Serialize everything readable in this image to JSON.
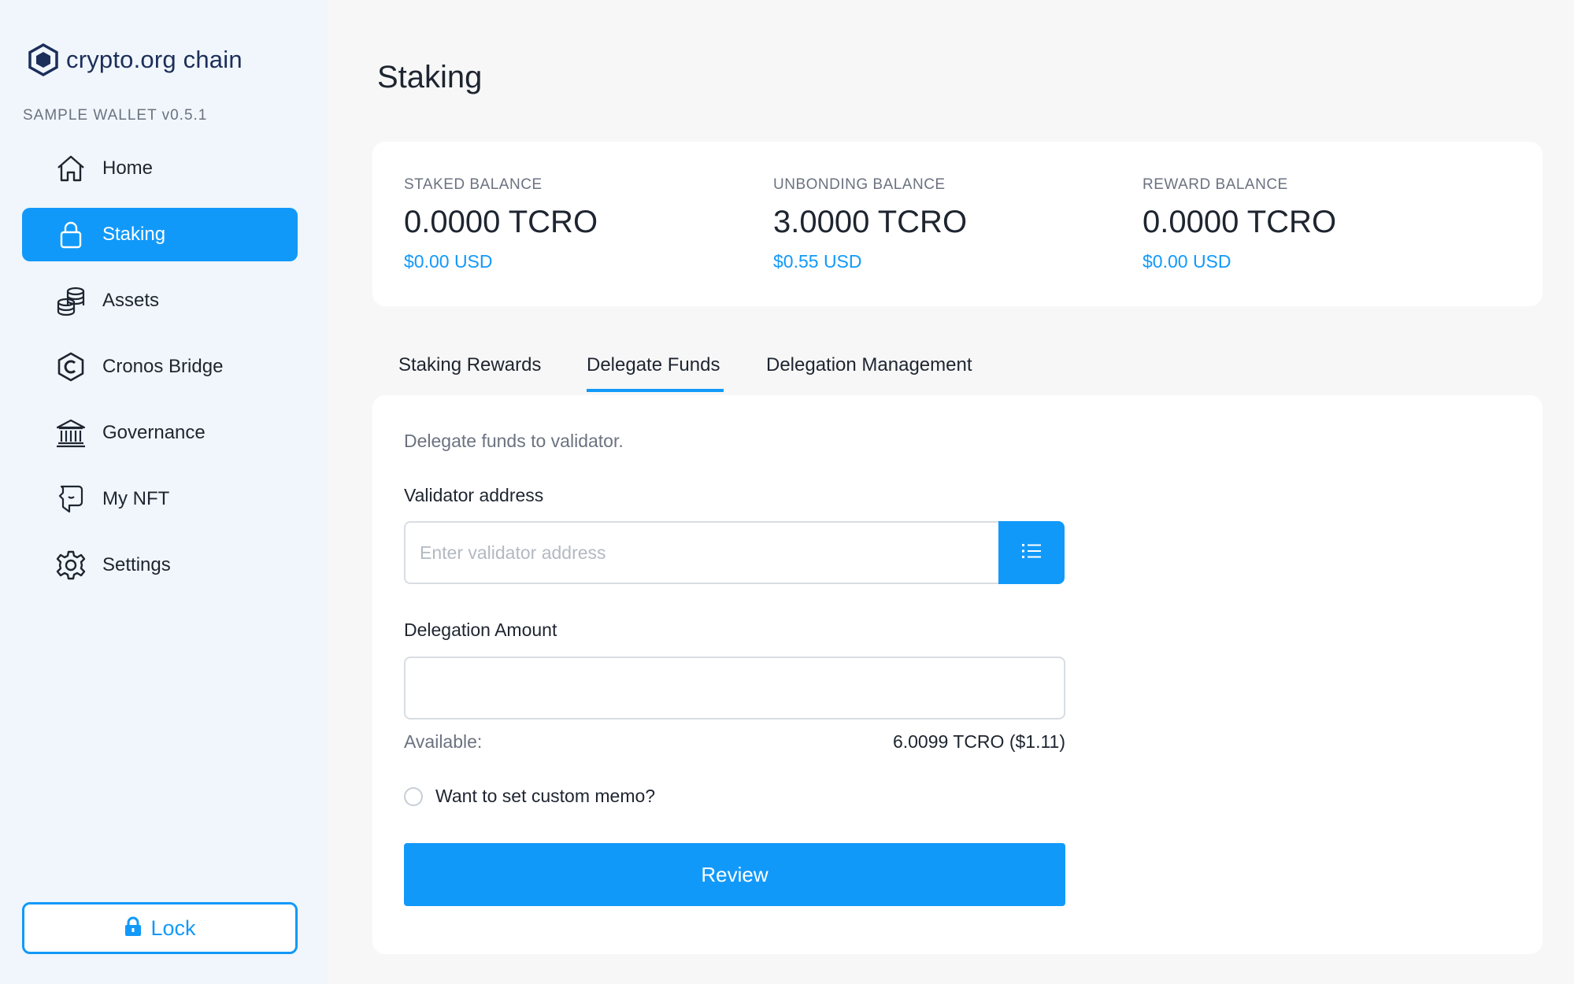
{
  "brand": {
    "name": "crypto.org chain",
    "version": "SAMPLE WALLET v0.5.1",
    "accent": "#1199fa",
    "logo_color": "#1c2e5a"
  },
  "sidebar": {
    "items": [
      {
        "label": "Home",
        "icon": "home-icon",
        "active": false
      },
      {
        "label": "Staking",
        "icon": "lock-icon",
        "active": true
      },
      {
        "label": "Assets",
        "icon": "coins-icon",
        "active": false
      },
      {
        "label": "Cronos Bridge",
        "icon": "cronos-icon",
        "active": false
      },
      {
        "label": "Governance",
        "icon": "bank-icon",
        "active": false
      },
      {
        "label": "My NFT",
        "icon": "nft-icon",
        "active": false
      },
      {
        "label": "Settings",
        "icon": "gear-icon",
        "active": false
      }
    ],
    "lock_label": "Lock"
  },
  "page": {
    "title": "Staking"
  },
  "balances": [
    {
      "title": "STAKED BALANCE",
      "value": "0.0000 TCRO",
      "usd": "$0.00 USD"
    },
    {
      "title": "UNBONDING BALANCE",
      "value": "3.0000 TCRO",
      "usd": "$0.55 USD"
    },
    {
      "title": "REWARD BALANCE",
      "value": "0.0000 TCRO",
      "usd": "$0.00 USD"
    }
  ],
  "tabs": [
    {
      "label": "Staking Rewards",
      "active": false
    },
    {
      "label": "Delegate Funds",
      "active": true
    },
    {
      "label": "Delegation Management",
      "active": false
    }
  ],
  "form": {
    "intro": "Delegate funds to validator.",
    "validator_label": "Validator address",
    "validator_placeholder": "Enter validator address",
    "validator_value": "",
    "amount_label": "Delegation Amount",
    "amount_value": "",
    "available_label": "Available:",
    "available_value": "6.0099 TCRO ($1.11)",
    "memo_label": "Want to set custom memo?",
    "memo_checked": false,
    "review_label": "Review"
  }
}
